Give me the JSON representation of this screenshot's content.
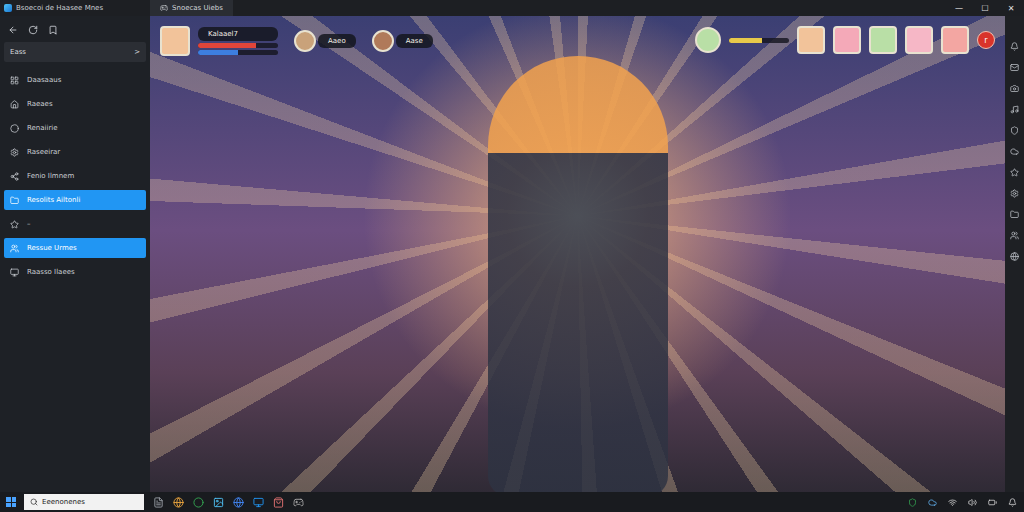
{
  "window": {
    "title": "Bsoecoi de Haasee Mnes",
    "tab": "Snoecas Uiebs",
    "controls": [
      "—",
      "☐",
      "✕"
    ]
  },
  "sidebar": {
    "search": "Eass",
    "search_arrow": ">",
    "items": [
      {
        "label": "Daasaaus",
        "selected": false
      },
      {
        "label": "Raeaes",
        "selected": false
      },
      {
        "label": "Renaiirie",
        "selected": false
      },
      {
        "label": "Raseeirar",
        "selected": false
      },
      {
        "label": "Fenio Ilmnem",
        "selected": false
      },
      {
        "label": "Resolits Ailtonli",
        "selected": true
      },
      {
        "label": "–",
        "selected": false
      },
      {
        "label": "Ressue Urmes",
        "selected": true
      },
      {
        "label": "Raasso Ilaees",
        "selected": false
      }
    ]
  },
  "hud": {
    "player": {
      "name": "Kalaael7",
      "health": 0.72,
      "mana": 0.5
    },
    "allies": [
      {
        "name": "Aaeo",
        "color": "#c9a27a"
      },
      {
        "name": "Aase",
        "color": "#b07a5a"
      }
    ],
    "enemy": {
      "health": 0.55
    },
    "party": [
      {
        "color": "#f2c39a"
      },
      {
        "color": "#f4a9b8"
      },
      {
        "color": "#b9dfa6"
      },
      {
        "color": "#f6b7c6"
      },
      {
        "color": "#f3a6a2"
      }
    ],
    "alert": "r"
  },
  "taskbar": {
    "search": "Eeenonenes"
  }
}
